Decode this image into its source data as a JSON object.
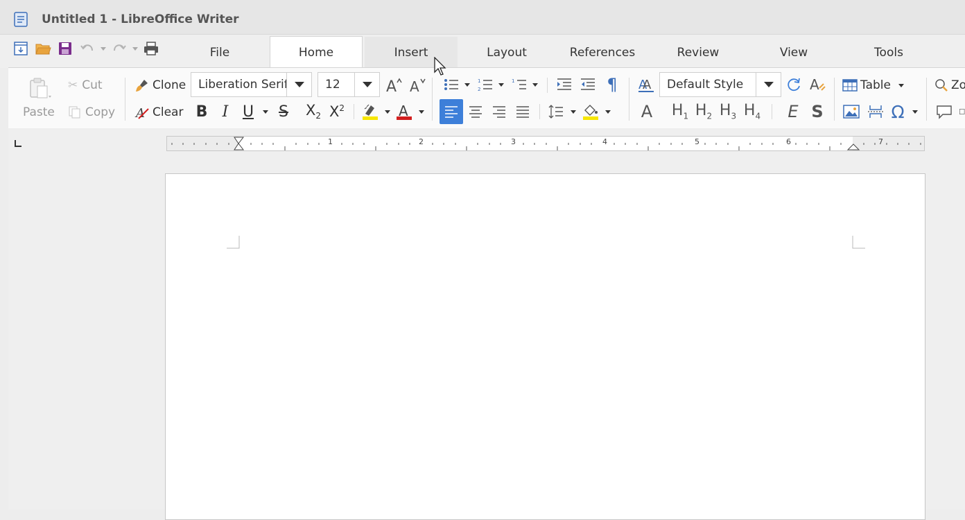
{
  "window": {
    "title": "Untitled 1 - LibreOffice Writer"
  },
  "tabs": [
    {
      "label": "File"
    },
    {
      "label": "Home"
    },
    {
      "label": "Insert"
    },
    {
      "label": "Layout"
    },
    {
      "label": "References"
    },
    {
      "label": "Review"
    },
    {
      "label": "View"
    },
    {
      "label": "Tools"
    }
  ],
  "active_tab": "Home",
  "clipboard": {
    "paste_label": "Paste",
    "cut_label": "Cut",
    "copy_label": "Copy"
  },
  "formatting": {
    "clone_label": "Clone",
    "clear_label": "Clear"
  },
  "font": {
    "name": "Liberation Serif",
    "size": "12"
  },
  "style": {
    "name": "Default Style"
  },
  "insert_group": {
    "table_label": "Table",
    "zoom_partial_label": "Zo"
  },
  "heading_buttons": {
    "h1": "H1",
    "h2": "H2",
    "h3": "H3",
    "h4": "H4"
  },
  "ruler": {
    "numbers": [
      "1",
      "2",
      "3",
      "4",
      "5",
      "6",
      "7"
    ]
  },
  "colors": {
    "accent_blue": "#3d7fd9",
    "highlight_yellow": "#f7e600",
    "font_color_red": "#d21f1f",
    "save_purple": "#7b2d8c",
    "open_orange": "#e8a33d"
  }
}
